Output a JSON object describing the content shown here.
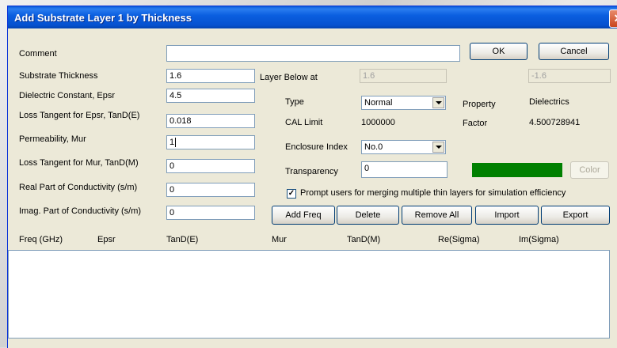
{
  "window": {
    "title": "Add Substrate Layer 1 by Thickness",
    "close_glyph": "✕"
  },
  "buttons": {
    "ok": "OK",
    "cancel": "Cancel",
    "color": "Color",
    "add_freq": "Add Freq",
    "delete": "Delete",
    "remove_all": "Remove All",
    "import": "Import",
    "export": "Export"
  },
  "fields": {
    "comment": {
      "label": "Comment",
      "value": ""
    },
    "substrate_thickness": {
      "label": "Substrate Thickness",
      "value": "1.6"
    },
    "dielectric_constant": {
      "label": "Dielectric Constant, Epsr",
      "value": "4.5"
    },
    "loss_tangent_epsr": {
      "label": "Loss Tangent for Epsr, TanD(E)",
      "value": "0.018"
    },
    "permeability": {
      "label": "Permeability, Mur",
      "value": "1"
    },
    "loss_tangent_mur": {
      "label": "Loss Tangent for Mur, TanD(M)",
      "value": "0"
    },
    "real_conductivity": {
      "label": "Real Part of Conductivity (s/m)",
      "value": "0"
    },
    "imag_conductivity": {
      "label": "Imag. Part of Conductivity (s/m)",
      "value": "0"
    }
  },
  "layer_below": {
    "label": "Layer Below at",
    "value": "1.6",
    "right_value": "-1.6"
  },
  "type": {
    "label": "Type",
    "selected": "Normal"
  },
  "cal_limit": {
    "label": "CAL Limit",
    "value": "1000000"
  },
  "enclosure": {
    "label": "Enclosure Index",
    "selected": "No.0"
  },
  "transparency": {
    "label": "Transparency",
    "value": "0"
  },
  "property": {
    "label": "Property",
    "value": "Dielectrics"
  },
  "factor": {
    "label": "Factor",
    "value": "4.500728941"
  },
  "swatch_color": "#008000",
  "prompt_checkbox": {
    "checked": true,
    "glyph": "✓",
    "label": "Prompt users for merging multiple thin layers for simulation efficiency"
  },
  "table": {
    "columns": [
      "Freq (GHz)",
      "Epsr",
      "TanD(E)",
      "Mur",
      "TanD(M)",
      "Re(Sigma)",
      "Im(Sigma)"
    ]
  }
}
